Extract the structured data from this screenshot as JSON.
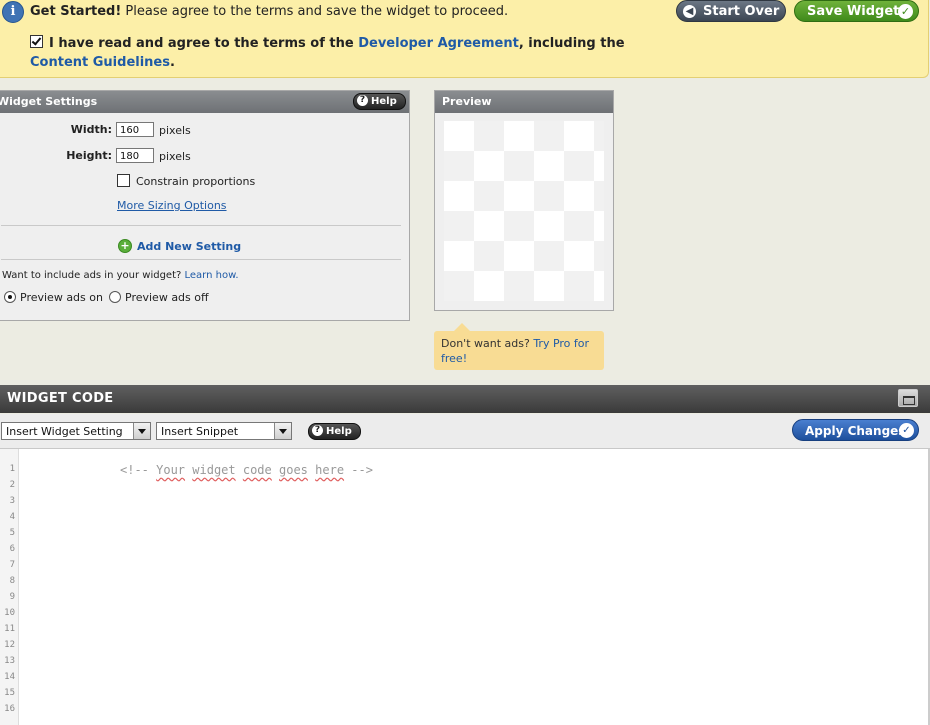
{
  "banner": {
    "get_started": "Get Started!",
    "message": "Please agree to the terms and save the widget to proceed.",
    "agree_checked": true,
    "agree_prefix": "I have read and agree to the terms of the",
    "developer_agreement": "Developer Agreement",
    "agree_mid": ", including the",
    "content_guidelines": "Content Guidelines",
    "agree_suffix": ".",
    "start_over": "Start Over",
    "save_widget": "Save Widget"
  },
  "settings": {
    "title": "Widget Settings",
    "help": "Help",
    "width_label": "Width:",
    "width_value": "160",
    "height_label": "Height:",
    "height_value": "180",
    "unit": "pixels",
    "constrain": "Constrain proportions",
    "constrain_checked": false,
    "more_sizing": "More Sizing Options",
    "add_setting": "Add New Setting",
    "ads_question": "Want to include ads in your widget?",
    "learn_how": "Learn how.",
    "ads_on": "Preview ads on",
    "ads_off": "Preview ads off",
    "ads_selected": "on"
  },
  "preview": {
    "title": "Preview",
    "tooltip_text": "Don't want ads?",
    "tooltip_link": "Try Pro for free!"
  },
  "code": {
    "title": "WIDGET CODE",
    "insert_setting": "Insert Widget Setting",
    "insert_snippet": "Insert Snippet",
    "help": "Help",
    "apply": "Apply Changes",
    "open": "<!-- ",
    "words": [
      "Your",
      "widget",
      "code",
      "goes",
      "here"
    ],
    "close": " -->",
    "line_numbers": [
      "1",
      "2",
      "3",
      "4",
      "5",
      "6",
      "7",
      "8",
      "9",
      "10",
      "11",
      "12",
      "13",
      "14",
      "15",
      "16"
    ]
  },
  "colors": {
    "banner_bg": "#fcefa8",
    "link": "#1f5aa6",
    "save_green": "#3f8a1b",
    "apply_blue": "#1d4f9c"
  }
}
